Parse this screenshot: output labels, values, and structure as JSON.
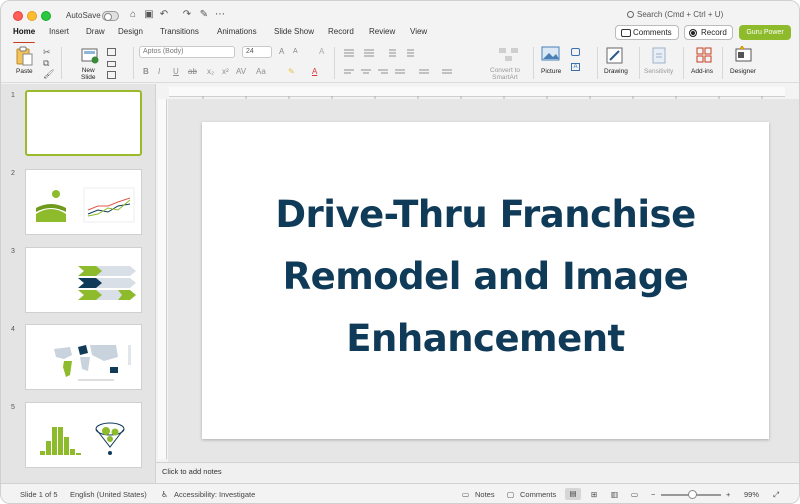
{
  "titlebar": {
    "autosave_label": "AutoSave",
    "search_placeholder": "Search (Cmd + Ctrl + U)"
  },
  "tabs": [
    "Home",
    "Insert",
    "Draw",
    "Design",
    "Transitions",
    "Animations",
    "Slide Show",
    "Record",
    "Review",
    "View"
  ],
  "actions": {
    "comments": "Comments",
    "record": "Record",
    "guru": "Guru Power"
  },
  "ribbon": {
    "paste": "Paste",
    "new_slide_1": "New",
    "new_slide_2": "Slide",
    "font_name": "Aptos (Body)",
    "font_size": "24",
    "convert_1": "Convert to",
    "convert_2": "SmartArt",
    "picture": "Picture",
    "drawing": "Drawing",
    "sensitivity": "Sensitivity",
    "addins": "Add-ins",
    "designer": "Designer"
  },
  "thumbnails": [
    "1",
    "2",
    "3",
    "4",
    "5"
  ],
  "slide": {
    "title_line1": "Drive-Thru Franchise",
    "title_line2": "Remodel and Image",
    "title_line3": "Enhancement"
  },
  "notes_placeholder": "Click to add notes",
  "status": {
    "slide_of": "Slide 1 of 5",
    "language": "English (United States)",
    "accessibility": "Accessibility: Investigate",
    "notes": "Notes",
    "comments": "Comments",
    "zoom": "99%"
  },
  "colors": {
    "accent_green": "#8dbb2b",
    "title_navy": "#0f3b58",
    "active_tab_underline": "#c43e1c"
  }
}
